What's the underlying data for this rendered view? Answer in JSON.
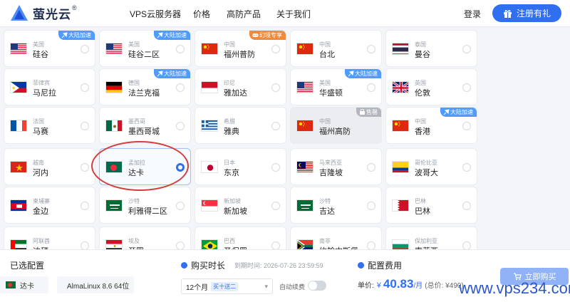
{
  "header": {
    "logo_text": "萤光云",
    "logo_reg": "®",
    "nav": [
      "VPS云服务器",
      "价格",
      "高防产品",
      "关于我们"
    ],
    "login": "登录",
    "register": "注册有礼"
  },
  "regions": [
    {
      "country": "美国",
      "city": "硅谷",
      "flag": "us",
      "badge": "大陆加速",
      "badge_color": "blue"
    },
    {
      "country": "美国",
      "city": "硅谷二区",
      "flag": "us",
      "badge": "大陆加速",
      "badge_color": "blue"
    },
    {
      "country": "中国",
      "city": "福州普防",
      "flag": "cn",
      "badge": "幻境专享",
      "badge_color": "orange"
    },
    {
      "country": "中国",
      "city": "台北",
      "flag": "cn"
    },
    {
      "country": "泰国",
      "city": "曼谷",
      "flag": "th"
    },
    {
      "country": "菲律宾",
      "city": "马尼拉",
      "flag": "ph"
    },
    {
      "country": "德国",
      "city": "法兰克福",
      "flag": "de",
      "badge": "大陆加速",
      "badge_color": "blue"
    },
    {
      "country": "印尼",
      "city": "雅加达",
      "flag": "id"
    },
    {
      "country": "美国",
      "city": "华盛顿",
      "flag": "us",
      "badge": "大陆加速",
      "badge_color": "blue"
    },
    {
      "country": "英国",
      "city": "伦敦",
      "flag": "uk"
    },
    {
      "country": "法国",
      "city": "马赛",
      "flag": "fr"
    },
    {
      "country": "墨西哥",
      "city": "墨西哥城",
      "flag": "mx"
    },
    {
      "country": "希腊",
      "city": "雅典",
      "flag": "gr"
    },
    {
      "country": "中国",
      "city": "福州高防",
      "flag": "cn",
      "badge": "售罄",
      "badge_color": "gray",
      "disabled": true
    },
    {
      "country": "中国",
      "city": "香港",
      "flag": "cn",
      "badge": "大陆加速",
      "badge_color": "blue"
    },
    {
      "country": "越南",
      "city": "河内",
      "flag": "vn"
    },
    {
      "country": "孟加拉",
      "city": "达卡",
      "flag": "bd",
      "selected": true
    },
    {
      "country": "日本",
      "city": "东京",
      "flag": "jp"
    },
    {
      "country": "马来西亚",
      "city": "吉隆坡",
      "flag": "my"
    },
    {
      "country": "哥伦比亚",
      "city": "波哥大",
      "flag": "co"
    },
    {
      "country": "柬埔寨",
      "city": "金边",
      "flag": "kh"
    },
    {
      "country": "沙特",
      "city": "利雅得二区",
      "flag": "sa"
    },
    {
      "country": "新加坡",
      "city": "新加坡",
      "flag": "sg"
    },
    {
      "country": "沙特",
      "city": "吉达",
      "flag": "sa"
    },
    {
      "country": "巴林",
      "city": "巴林",
      "flag": "bh"
    },
    {
      "country": "阿联酋",
      "city": "迪拜",
      "flag": "ae"
    },
    {
      "country": "埃及",
      "city": "开罗",
      "flag": "eg"
    },
    {
      "country": "巴西",
      "city": "圣保罗",
      "flag": "br"
    },
    {
      "country": "南非",
      "city": "约翰内斯堡",
      "flag": "za"
    },
    {
      "country": "保加利亚",
      "city": "索菲亚",
      "flag": "bg"
    }
  ],
  "config": {
    "title": "已选配置",
    "region": "达卡",
    "os": "AlmaLinux 8.6 64位"
  },
  "duration": {
    "title": "购买时长",
    "expire": "到期时间: 2026-07-26 23:59:59",
    "selected": "12个月",
    "tag": "买十送二",
    "renew_label": "自动续费"
  },
  "fee": {
    "title": "配置费用",
    "unit_label": "单价:",
    "currency": "¥",
    "price": "40.83",
    "per": "/月",
    "total": "(总价: ¥490)"
  },
  "buy_button": "立即购买",
  "watermark": "www.vps234.com",
  "colors": {
    "accent": "#2f6ff0",
    "annotation": "#d43c3c"
  }
}
